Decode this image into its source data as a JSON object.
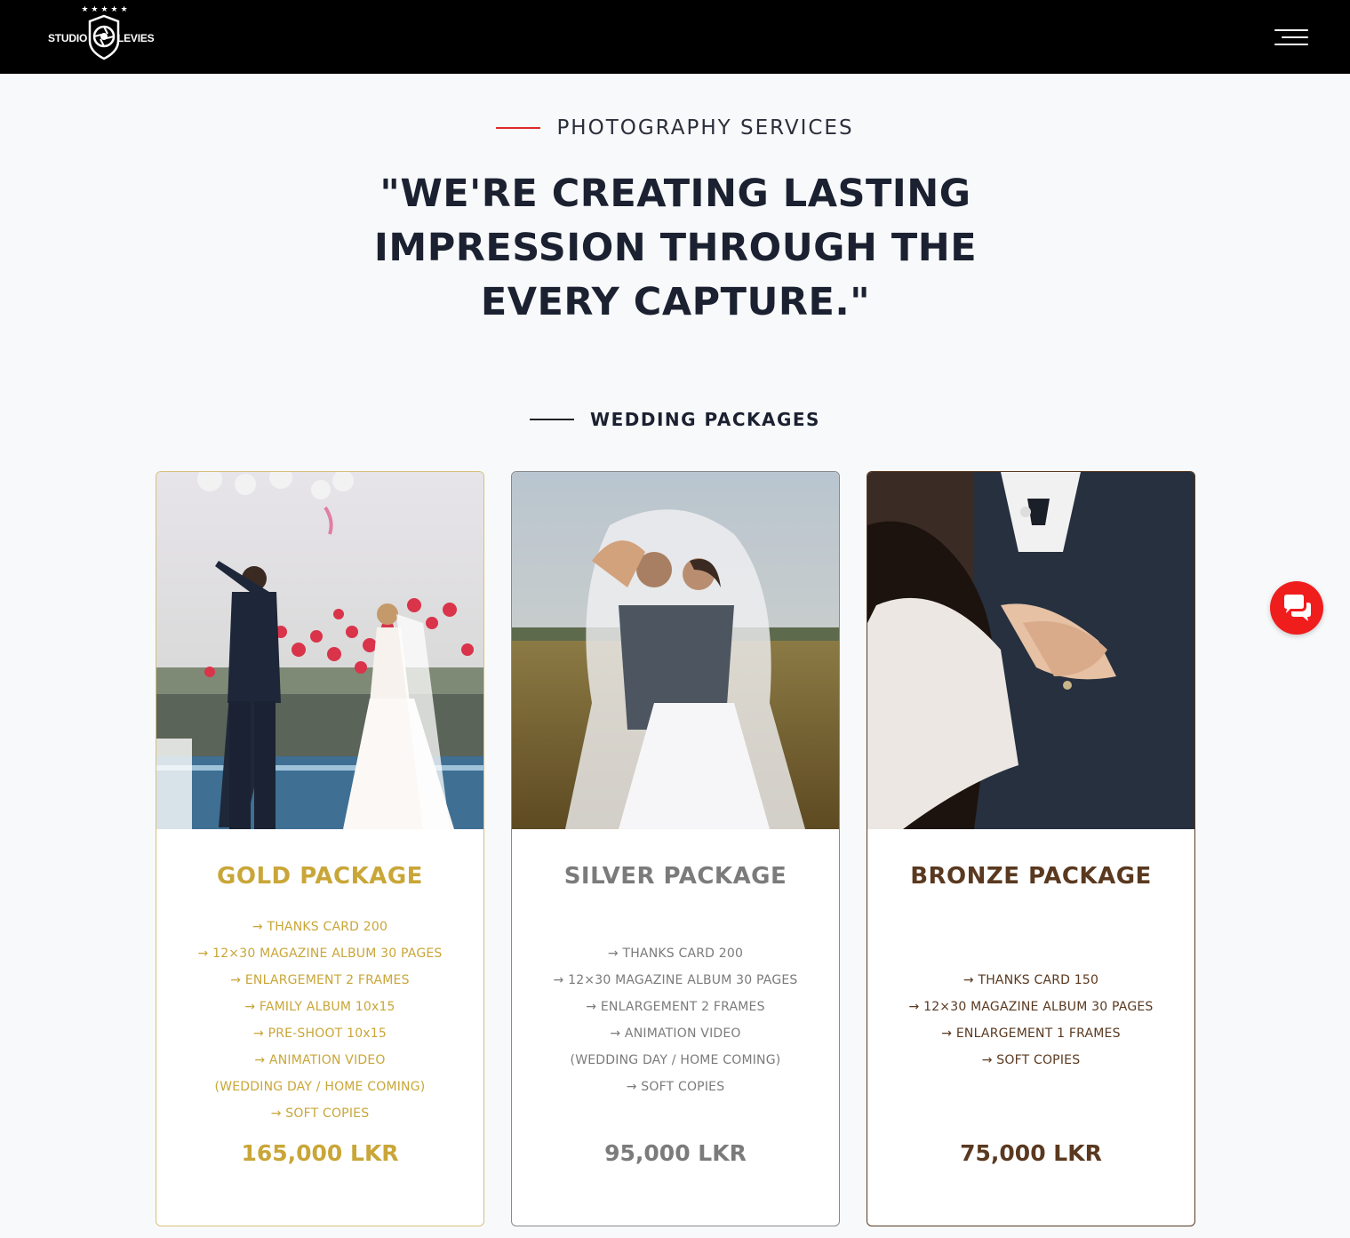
{
  "header": {
    "logo": {
      "left_text": "STUDIO",
      "right_text": "LEVIES",
      "stars": "★★★★★"
    },
    "menu_icon": "hamburger-menu-icon"
  },
  "intro": {
    "eyebrow": "PHOTOGRAPHY SERVICES",
    "headline": "\"WE'RE CREATING LASTING IMPRESSION THROUGH THE EVERY CAPTURE.\""
  },
  "packages_section": {
    "eyebrow": "WEDDING PACKAGES",
    "packages": [
      {
        "title": "GOLD PACKAGE",
        "color": "#c9a638",
        "features": [
          "→ THANKS CARD 200",
          "→ 12×30 MAGAZINE ALBUM 30 PAGES",
          "→ ENLARGEMENT 2 FRAMES",
          "→ FAMILY ALBUM 10x15",
          "→ PRE-SHOOT 10x15",
          "→ ANIMATION VIDEO",
          "(WEDDING DAY / HOME COMING)",
          "→ SOFT COPIES"
        ],
        "price": "165,000 LKR"
      },
      {
        "title": "SILVER PACKAGE",
        "color": "#7b7b7b",
        "features": [
          "→ THANKS CARD 200",
          "→ 12×30 MAGAZINE ALBUM 30 PAGES",
          "→ ENLARGEMENT 2 FRAMES",
          "→ ANIMATION VIDEO",
          "(WEDDING DAY / HOME COMING)",
          "→ SOFT COPIES"
        ],
        "price": "95,000 LKR"
      },
      {
        "title": "BRONZE PACKAGE",
        "color": "#5a3920",
        "features": [
          "→ THANKS CARD 150",
          "→ 12×30 MAGAZINE ALBUM 30 PAGES",
          "→ ENLARGEMENT 1 FRAMES",
          "→ SOFT COPIES"
        ],
        "price": "75,000 LKR"
      }
    ]
  },
  "chat_widget": {
    "icon": "chat-bubbles-icon",
    "color": "#f01d1d"
  }
}
